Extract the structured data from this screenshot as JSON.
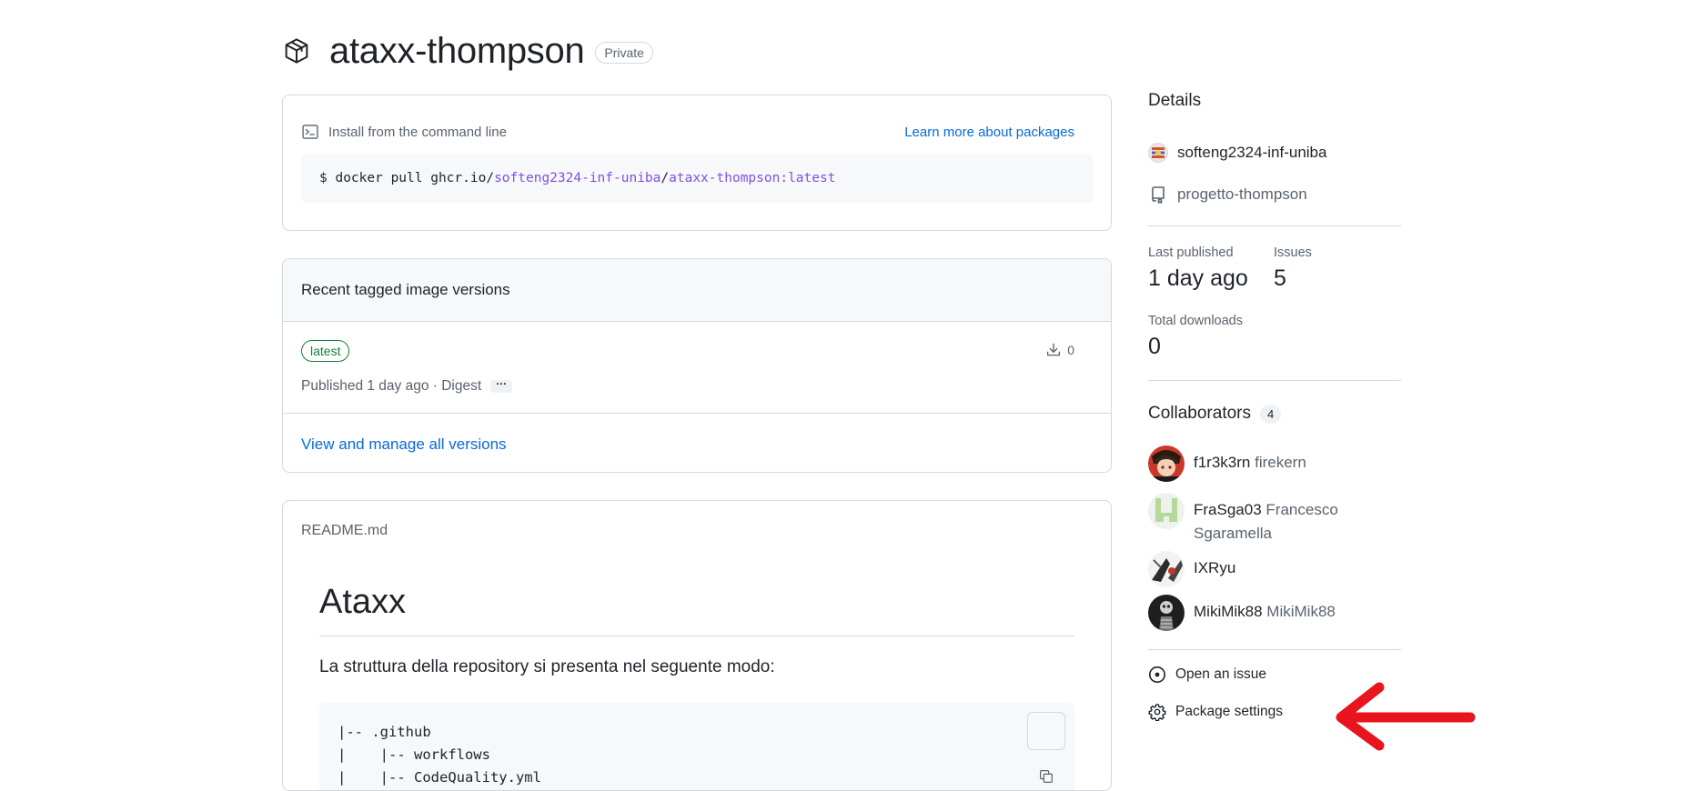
{
  "header": {
    "title": "ataxx-thompson",
    "visibility": "Private"
  },
  "install": {
    "label": "Install from the command line",
    "learn_more": "Learn more about packages",
    "command": {
      "prefix": "$ docker pull ghcr.io/",
      "org": "softeng2324-inf-uniba",
      "slash": "/",
      "image": "ataxx-thompson:latest"
    }
  },
  "versions": {
    "heading": "Recent tagged image versions",
    "items": [
      {
        "tag": "latest",
        "published": "Published 1 day ago · Digest",
        "ellipsis": "···",
        "downloads": "0"
      }
    ],
    "view_all": "View and manage all versions"
  },
  "readme": {
    "filename": "README.md",
    "h1": "Ataxx",
    "paragraph": "La struttura della repository si presenta nel seguente modo:",
    "code_lines": [
      "|-- .github",
      "|    |-- workflows",
      "|    |-- CodeQuality.yml"
    ]
  },
  "details": {
    "heading": "Details",
    "owner": "softeng2324-inf-uniba",
    "repo": "progetto-thompson",
    "last_published_label": "Last published",
    "last_published_value": "1 day ago",
    "issues_label": "Issues",
    "issues_value": "5",
    "downloads_label": "Total downloads",
    "downloads_value": "0"
  },
  "collaborators": {
    "heading": "Collaborators",
    "count": "4",
    "items": [
      {
        "login": "f1r3k3rn",
        "name": "firekern"
      },
      {
        "login": "FraSga03",
        "name": "Francesco Sgaramella"
      },
      {
        "login": "IXRyu",
        "name": ""
      },
      {
        "login": "MikiMik88",
        "name": "MikiMik88"
      }
    ]
  },
  "actions": {
    "open_issue": "Open an issue",
    "package_settings": "Package settings"
  },
  "colors": {
    "link": "#0969da",
    "tag_green": "#1a7f37",
    "purple": "#8250df",
    "annotation_arrow": "#e8141e"
  },
  "icons": [
    "package-icon",
    "terminal-icon",
    "download-icon",
    "copy-icon",
    "org-avatar-icon",
    "repo-icon",
    "issue-circle-icon",
    "gear-icon"
  ]
}
